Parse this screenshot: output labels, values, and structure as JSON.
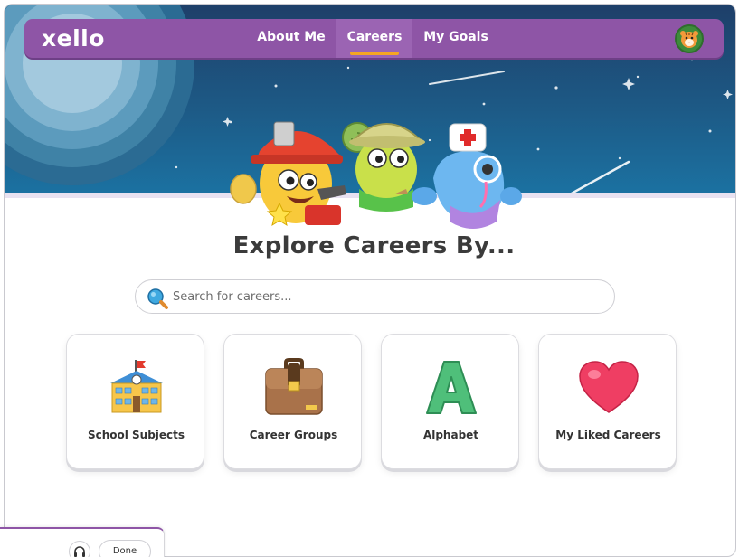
{
  "brand": {
    "logo_text": "xello",
    "accent_color": "#8e55a6",
    "highlight_color": "#f5a623"
  },
  "nav": {
    "items": [
      {
        "label": "About Me",
        "active": false
      },
      {
        "label": "Careers",
        "active": true
      },
      {
        "label": "My Goals",
        "active": false
      }
    ],
    "avatar_icon": "tiger-avatar-icon"
  },
  "hero": {
    "mascots": [
      "firefighter-mascot",
      "explorer-mascot",
      "nurse-mascot"
    ]
  },
  "main": {
    "headline": "Explore Careers By...",
    "search": {
      "placeholder": "Search for careers...",
      "icon": "search-icon"
    },
    "cards": [
      {
        "label": "School Subjects",
        "icon": "school-building-icon"
      },
      {
        "label": "Career Groups",
        "icon": "briefcase-icon"
      },
      {
        "label": "Alphabet",
        "icon": "letter-a-icon"
      },
      {
        "label": "My Liked Careers",
        "icon": "heart-icon"
      }
    ]
  },
  "footer": {
    "audio_icon": "headphones-icon",
    "done_label": "Done"
  }
}
